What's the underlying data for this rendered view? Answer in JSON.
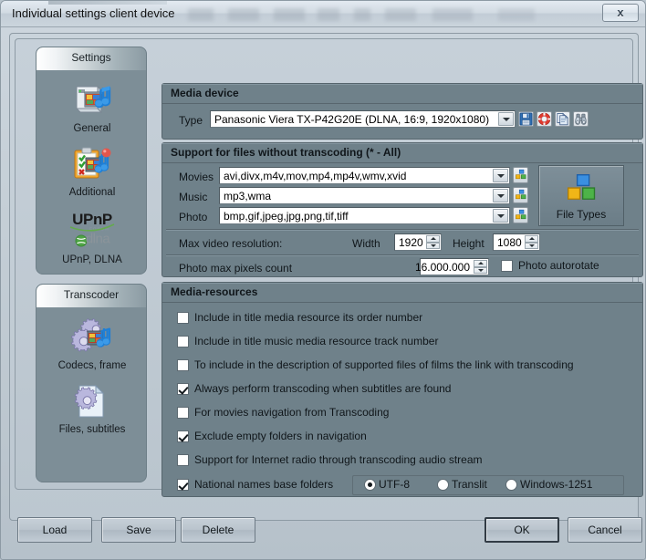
{
  "window": {
    "title": "Individual settings client device",
    "close_label": "x"
  },
  "sidebar": {
    "groups": [
      {
        "header": "Settings",
        "items": [
          {
            "label": "General",
            "icon": "media-device-icon"
          },
          {
            "label": "Additional",
            "icon": "clipboard-checklist-icon"
          },
          {
            "label": "UPnP, DLNA",
            "icon": "upnp-dlna-logo-icon",
            "logo_primary": "UPnP",
            "logo_secondary": "dlna",
            "logo_sub": "FORUM"
          }
        ]
      },
      {
        "header": "Transcoder",
        "items": [
          {
            "label": "Codecs, frame",
            "icon": "gears-media-icon"
          },
          {
            "label": "Files, subtitles",
            "icon": "document-gear-icon"
          }
        ]
      }
    ]
  },
  "media_device": {
    "title": "Media device",
    "type_label": "Type",
    "type_value": "Panasonic Viera TX-P42G20E (DLNA, 16:9, 1920x1080)",
    "tool_icons": [
      "save-floppy-icon",
      "lifebuoy-icon",
      "copy-pages-icon",
      "binoculars-icon"
    ]
  },
  "support": {
    "title": "Support for files without transcoding (* - All)",
    "rows": [
      {
        "label": "Movies",
        "value": "avi,divx,m4v,mov,mp4,mp4v,wmv,xvid"
      },
      {
        "label": "Music",
        "value": "mp3,wma"
      },
      {
        "label": "Photo",
        "value": "bmp,gif,jpeg,jpg,png,tif,tiff"
      }
    ],
    "file_types_button": "File Types",
    "max_res_label": "Max video resolution:",
    "width_label": "Width",
    "width_value": "1920",
    "height_label": "Height",
    "height_value": "1080",
    "photo_max_label": "Photo max pixels count",
    "photo_max_value": "16.000.000",
    "photo_autorotate_label": "Photo autorotate",
    "photo_autorotate_checked": false
  },
  "media_resources": {
    "title": "Media-resources",
    "checkboxes": [
      {
        "label": "Include in title media resource its order number",
        "checked": false
      },
      {
        "label": "Include in title music media resource track number",
        "checked": false
      },
      {
        "label": "To include in the description of supported files of films the link with transcoding",
        "checked": false
      },
      {
        "label": "Always perform transcoding when subtitles are found",
        "checked": true
      },
      {
        "label": "For movies navigation from Transcoding",
        "checked": false
      },
      {
        "label": "Exclude empty folders in navigation",
        "checked": true
      },
      {
        "label": "Support for Internet radio through transcoding audio stream",
        "checked": false
      },
      {
        "label": "National names base folders",
        "checked": true
      }
    ],
    "encoding_options": [
      {
        "label": "UTF-8",
        "selected": true
      },
      {
        "label": "Translit",
        "selected": false
      },
      {
        "label": "Windows-1251",
        "selected": false
      }
    ]
  },
  "buttons": {
    "load": "Load",
    "save": "Save",
    "delete": "Delete",
    "ok": "OK",
    "cancel": "Cancel"
  },
  "colors": {
    "panel": "#6f818a",
    "window": "#c4ced6",
    "titlebar": "#d2dbe3",
    "text": "#10161a"
  }
}
